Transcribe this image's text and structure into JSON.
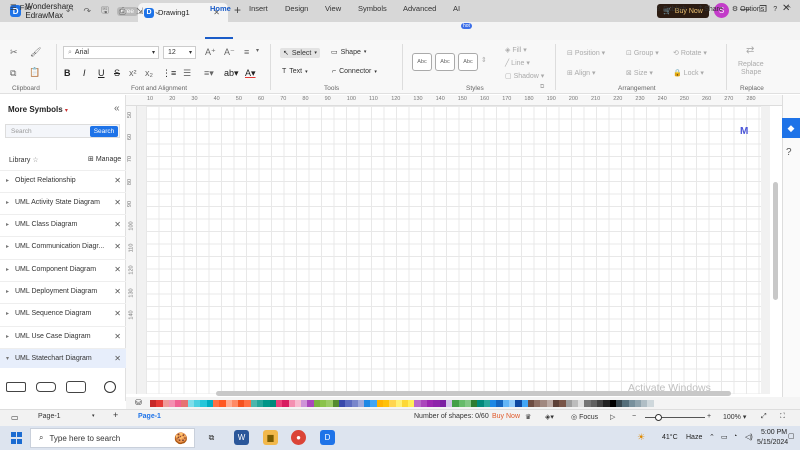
{
  "titlebar": {
    "app_name": "Wondershare EdrawMax",
    "free_badge": "Free",
    "doc_tab": "Drawing1",
    "buy_now": "Buy Now",
    "user_initial": "S"
  },
  "menubar": {
    "file": "File",
    "tabs": [
      "Home",
      "Insert",
      "Design",
      "View",
      "Symbols",
      "Advanced",
      "AI"
    ],
    "ai_badge": "hot",
    "right": [
      "Publish",
      "Share",
      "Options"
    ]
  },
  "ribbon": {
    "font": "Arial",
    "font_size": "12",
    "groups": [
      "Clipboard",
      "Font and Alignment",
      "Tools",
      "Styles",
      "Arrangement",
      "Replace"
    ],
    "tools": {
      "select": "Select",
      "shape": "Shape",
      "text": "Text",
      "connector": "Connector"
    },
    "style_swatch": "Abc",
    "style_props": [
      "Fill",
      "Line",
      "Shadow"
    ],
    "arrange": [
      "Position",
      "Group",
      "Rotate",
      "Align",
      "Size",
      "Lock"
    ],
    "replace": [
      "Replace",
      "Shape"
    ]
  },
  "left_panel": {
    "title": "More Symbols",
    "search_placeholder": "Search",
    "search_button": "Search",
    "library_label": "Library",
    "manage": "Manage",
    "libraries": [
      "Object Relationship",
      "UML Activity State Diagram",
      "UML Class Diagram",
      "UML Communication Diagr...",
      "UML Component Diagram",
      "UML Deployment Diagram",
      "UML Sequence Diagram",
      "UML Use Case Diagram",
      "UML Statechart Diagram"
    ]
  },
  "ruler": {
    "top": [
      "10",
      "20",
      "30",
      "40",
      "50",
      "60",
      "70",
      "80",
      "90",
      "100",
      "110",
      "120",
      "130",
      "140",
      "150",
      "160",
      "170",
      "180",
      "190",
      "200",
      "210",
      "220",
      "230",
      "240",
      "250",
      "260",
      "270",
      "280"
    ],
    "left": [
      "50",
      "60",
      "70",
      "80",
      "90",
      "100",
      "110",
      "120",
      "130",
      "140"
    ]
  },
  "canvas": {
    "watermark": "Activate Windows"
  },
  "palette": [
    "#c62828",
    "#e53935",
    "#ef9a9a",
    "#f48fb1",
    "#f06292",
    "#e57373",
    "#80deea",
    "#4dd0e1",
    "#26c6da",
    "#00acc1",
    "#ff7043",
    "#ff5722",
    "#ffab91",
    "#ff8a65",
    "#f4511e",
    "#ff7043",
    "#4db6ac",
    "#26a69a",
    "#009688",
    "#00897b",
    "#ec407a",
    "#d81b60",
    "#f48fb1",
    "#f8bbd0",
    "#ce93d8",
    "#ab47bc",
    "#7cb342",
    "#8bc34a",
    "#9ccc65",
    "#558b2f",
    "#3949ab",
    "#5c6bc0",
    "#7986cb",
    "#9fa8da",
    "#1e88e5",
    "#42a5f5",
    "#ffb300",
    "#ffc107",
    "#ffd54f",
    "#fff176",
    "#fdd835",
    "#ffee58",
    "#ba68c8",
    "#ab47bc",
    "#9c27b0",
    "#8e24aa",
    "#7b1fa2",
    "#d1c4e9",
    "#43a047",
    "#66bb6a",
    "#81c784",
    "#2e7d32",
    "#00897b",
    "#26a69a",
    "#1e88e5",
    "#1565c0",
    "#64b5f6",
    "#90caf9",
    "#0d47a1",
    "#42a5f5",
    "#6d4c41",
    "#8d6e63",
    "#a1887f",
    "#bcaaa4",
    "#5d4037",
    "#795548",
    "#9e9e9e",
    "#bdbdbd",
    "#e0e0e0",
    "#757575",
    "#616161",
    "#424242",
    "#212121",
    "#000000",
    "#37474f",
    "#546e7a",
    "#78909c",
    "#90a4ae",
    "#b0bec5",
    "#cfd8dc"
  ],
  "status": {
    "page_select": "Page-1",
    "page_tab": "Page-1",
    "shapes": "Number of shapes: 0/60",
    "buy_now": "Buy Now",
    "focus": "Focus",
    "zoom": "100%"
  },
  "taskbar": {
    "search_placeholder": "Type here to search",
    "weather_temp": "41°C",
    "weather_text": "Haze",
    "time": "5:00 PM",
    "date": "5/15/2024"
  }
}
